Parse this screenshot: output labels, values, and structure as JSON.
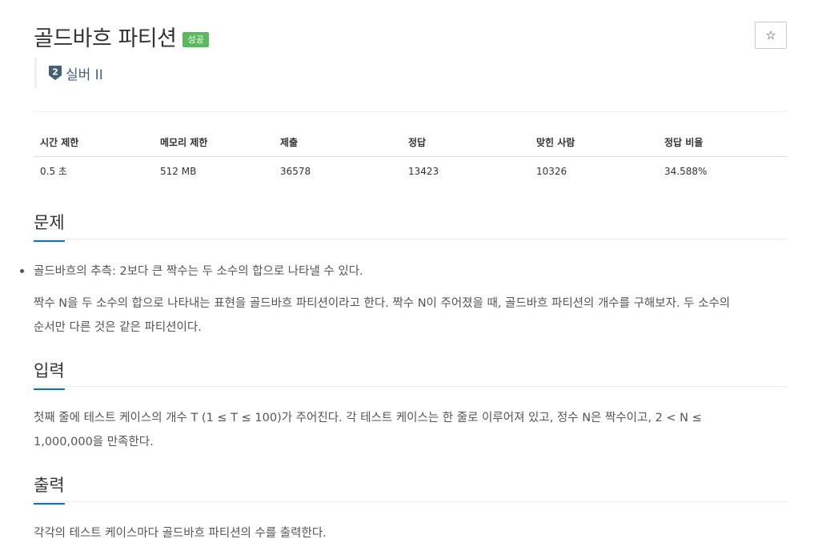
{
  "problem": {
    "title": "골드바흐 파티션",
    "result_badge": "성공",
    "star_icon": "☆",
    "tier_label": "실버 II",
    "tier_number": "2",
    "tier_color": "#435f7a"
  },
  "info_table": {
    "headers": [
      "시간 제한",
      "메모리 제한",
      "제출",
      "정답",
      "맞힌 사람",
      "정답 비율"
    ],
    "values": [
      "0.5 초",
      "512 MB",
      "36578",
      "13423",
      "10326",
      "34.588%"
    ]
  },
  "sections": {
    "problem": {
      "title": "문제",
      "bullet": "골드바흐의 추측: 2보다 큰 짝수는 두 소수의 합으로 나타낼 수 있다.",
      "body_line1": "짝수 N을 두 소수의 합으로 나타내는 표현을 골드바흐 파티션이라고 한다. 짝수 N이 주어졌을 때, 골드바흐 파티션의 개수를 구해보자. 두 소수의",
      "body_line2": "순서만 다른 것은 같은 파티션이다."
    },
    "input": {
      "title": "입력",
      "body_line1": "첫째 줄에 테스트 케이스의 개수 T (1 ≤ T ≤ 100)가 주어진다. 각 테스트 케이스는 한 줄로 이루어져 있고, 정수 N은 짝수이고, 2 < N ≤",
      "body_line2": "1,000,000을 만족한다."
    },
    "output": {
      "title": "출력",
      "body": "각각의 테스트 케이스마다 골드바흐 파티션의 수를 출력한다."
    }
  },
  "colors": {
    "accent": "#0076c0",
    "success": "#5cb85c"
  }
}
